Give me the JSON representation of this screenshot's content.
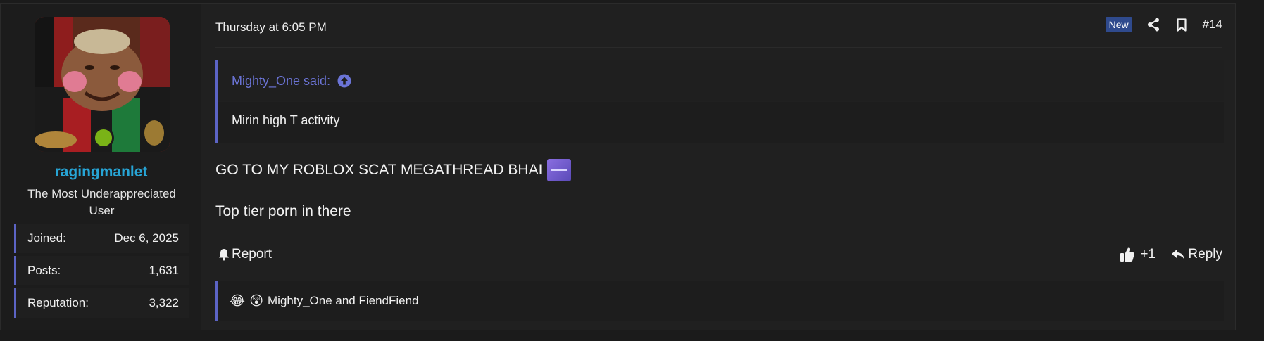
{
  "post": {
    "date": "Thursday at 6:05 PM",
    "badge_new": "New",
    "post_number": "#14",
    "quote": {
      "author_line": "Mighty_One said:",
      "text": "Mirin high T activity"
    },
    "message_line1": "GO TO MY ROBLOX SCAT MEGATHREAD BHAI",
    "message_line2": "Top tier porn in there",
    "actions": {
      "report": "Report",
      "like_count": "+1",
      "reply": "Reply"
    },
    "reactions": {
      "emojis": [
        "😂",
        "😲"
      ],
      "names": "Mighty_One and FiendFiend"
    }
  },
  "user": {
    "username": "ragingmanlet",
    "title": "The Most Underappreciated User",
    "stats": [
      {
        "label": "Joined:",
        "value": "Dec 6, 2025"
      },
      {
        "label": "Posts:",
        "value": "1,631"
      },
      {
        "label": "Reputation:",
        "value": "3,322"
      }
    ]
  },
  "colors": {
    "accent": "#5c64c5",
    "username": "#27a5d6",
    "online": "#7ab317",
    "badge_new": "#2f4a8d"
  }
}
